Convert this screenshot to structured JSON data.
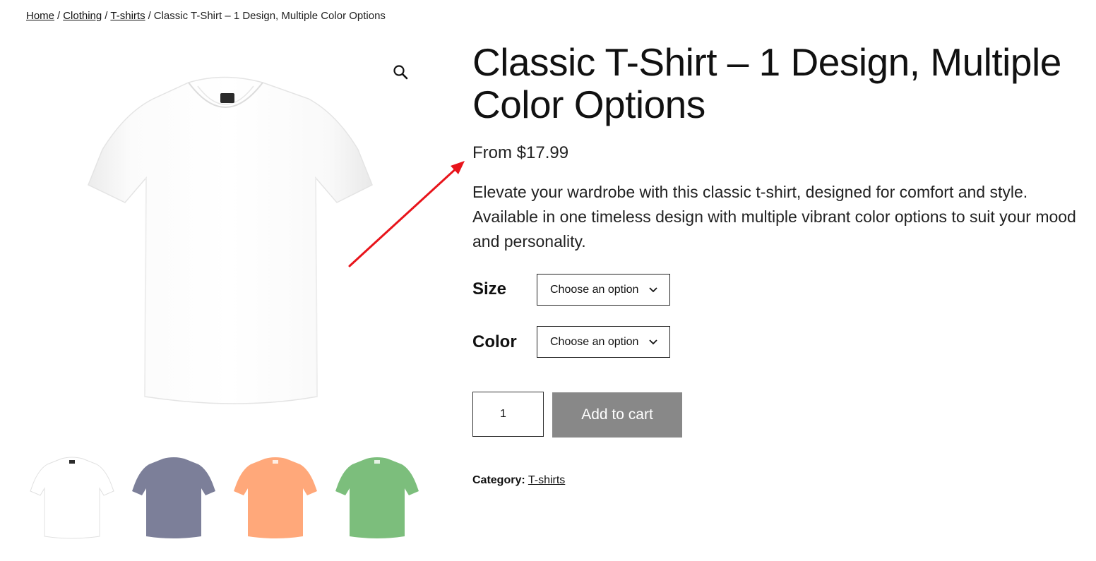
{
  "breadcrumb": {
    "items": [
      "Home",
      "Clothing",
      "T-shirts"
    ],
    "separator": "/",
    "current": "Classic T-Shirt – 1 Design, Multiple Color Options"
  },
  "product": {
    "title": "Classic T-Shirt – 1 Design, Multiple Color Options",
    "price": "From $17.99",
    "description": "Elevate your wardrobe with this classic t-shirt, designed for comfort and style. Available in one timeless design with multiple vibrant color options to suit your mood and personality.",
    "variations": [
      {
        "label": "Size",
        "value": "Choose an option"
      },
      {
        "label": "Color",
        "value": "Choose an option"
      }
    ],
    "quantity": "1",
    "add_to_cart": "Add to cart",
    "category_label": "Category:",
    "category": "T-shirts"
  },
  "gallery": {
    "zoom_icon": "magnifier-icon",
    "thumb_colors": [
      "#ffffff",
      "#7c7f99",
      "#ffa87a",
      "#7cbe7c"
    ]
  },
  "annotation": {
    "arrow_color": "#e8141b"
  }
}
